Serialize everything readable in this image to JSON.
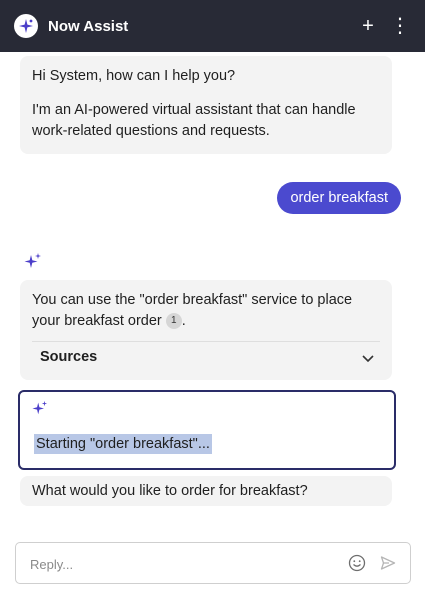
{
  "header": {
    "title": "Now Assist",
    "logo_icon": "now-assist-sparkle-logo",
    "new_chat_label": "+",
    "menu_label": "⋮"
  },
  "messages": {
    "greeting_line1": "Hi System, how can I help you?",
    "greeting_line2": "I'm an AI-powered virtual assistant that can handle work-related questions and requests.",
    "user_message": "order breakfast",
    "service_text": "You can use the \"order breakfast\" service to place your breakfast order",
    "citation": "1",
    "sources_label": "Sources",
    "starting_text": "Starting \"order breakfast\"...",
    "ask_text": "What would you like to order for breakfast?"
  },
  "reply": {
    "placeholder": "Reply...",
    "emoji_icon": "emoji-smile-icon",
    "send_icon": "send-icon"
  },
  "colors": {
    "header_bg": "#282a36",
    "user_bubble": "#4b4acf",
    "sparkle": "#4b3ec9",
    "focus_border": "#2a2c68",
    "highlight": "#b8c7e6"
  }
}
